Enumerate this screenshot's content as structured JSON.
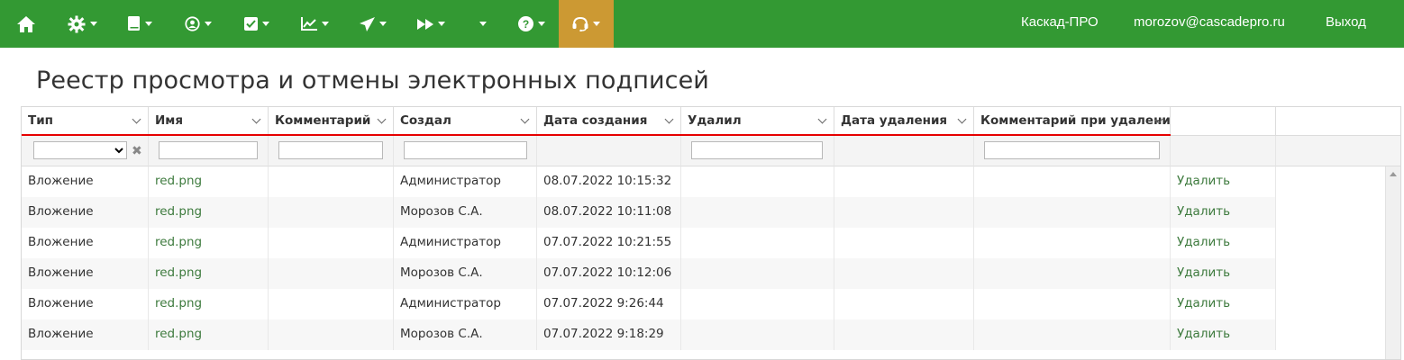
{
  "nav": {
    "items": [
      {
        "name": "home-icon"
      },
      {
        "name": "gear-icon"
      },
      {
        "name": "book-icon"
      },
      {
        "name": "user-circle-icon"
      },
      {
        "name": "checkbox-icon"
      },
      {
        "name": "line-chart-icon"
      },
      {
        "name": "paper-plane-icon"
      },
      {
        "name": "fast-forward-icon"
      },
      {
        "name": "dropdown-icon"
      },
      {
        "name": "question-circle-icon"
      },
      {
        "name": "headset-icon",
        "active": true
      }
    ],
    "org": "Каскад-ПРО",
    "user": "morozov@cascadepro.ru",
    "logout": "Выход",
    "colors": {
      "bar": "#339933",
      "active": "#cc9933"
    }
  },
  "page": {
    "title": "Реестр просмотра и отмены электронных подписей"
  },
  "grid": {
    "columns": [
      {
        "label": "Тип"
      },
      {
        "label": "Имя"
      },
      {
        "label": "Комментарий"
      },
      {
        "label": "Создал"
      },
      {
        "label": "Дата создания"
      },
      {
        "label": "Удалил"
      },
      {
        "label": "Дата удаления"
      },
      {
        "label": "Комментарий при удалении"
      }
    ],
    "rows": [
      {
        "type": "Вложение",
        "name": "red.png",
        "comment": "",
        "created_by": "Администратор",
        "created_at": "08.07.2022 10:15:32",
        "deleted_by": "",
        "deleted_at": "",
        "delete_comment": "",
        "action": "Удалить"
      },
      {
        "type": "Вложение",
        "name": "red.png",
        "comment": "",
        "created_by": "Морозов С.А.",
        "created_at": "08.07.2022 10:11:08",
        "deleted_by": "",
        "deleted_at": "",
        "delete_comment": "",
        "action": "Удалить"
      },
      {
        "type": "Вложение",
        "name": "red.png",
        "comment": "",
        "created_by": "Администратор",
        "created_at": "07.07.2022 10:21:55",
        "deleted_by": "",
        "deleted_at": "",
        "delete_comment": "",
        "action": "Удалить"
      },
      {
        "type": "Вложение",
        "name": "red.png",
        "comment": "",
        "created_by": "Морозов С.А.",
        "created_at": "07.07.2022 10:12:06",
        "deleted_by": "",
        "deleted_at": "",
        "delete_comment": "",
        "action": "Удалить"
      },
      {
        "type": "Вложение",
        "name": "red.png",
        "comment": "",
        "created_by": "Администратор",
        "created_at": "07.07.2022 9:26:44",
        "deleted_by": "",
        "deleted_at": "",
        "delete_comment": "",
        "action": "Удалить"
      },
      {
        "type": "Вложение",
        "name": "red.png",
        "comment": "",
        "created_by": "Морозов С.А.",
        "created_at": "07.07.2022 9:18:29",
        "deleted_by": "",
        "deleted_at": "",
        "delete_comment": "",
        "action": "Удалить"
      }
    ],
    "colors": {
      "highlight": "#e60000",
      "link": "#3d7a3d"
    }
  }
}
